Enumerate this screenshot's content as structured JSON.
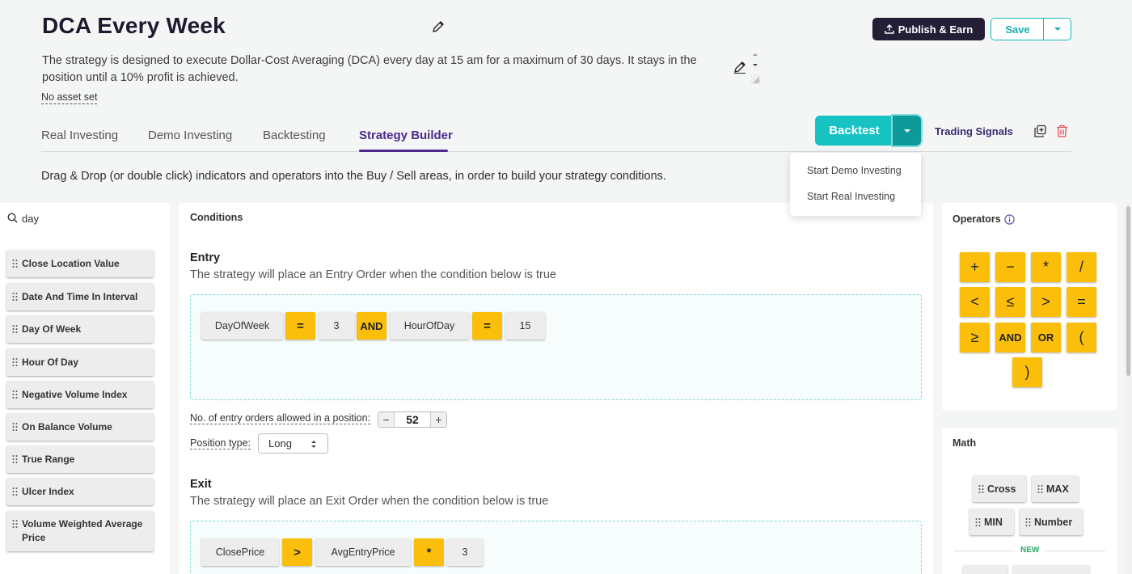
{
  "header": {
    "title": "DCA Every Week",
    "description": "The strategy is designed to execute Dollar-Cost Averaging (DCA) every day at 15 am for a maximum of 30 days. It stays in the position until a 10% profit is achieved.",
    "asset_link": "No asset set",
    "publish_label": "Publish & Earn",
    "save_label": "Save"
  },
  "tabs": [
    {
      "label": "Real Investing"
    },
    {
      "label": "Demo Investing"
    },
    {
      "label": "Backtesting"
    },
    {
      "label": "Strategy Builder",
      "active": true
    }
  ],
  "actions": {
    "backtest_label": "Backtest",
    "trading_signals_label": "Trading Signals",
    "dropdown_items": [
      "Start Demo Investing",
      "Start Real Investing"
    ]
  },
  "hint": "Drag & Drop (or double click) indicators and operators into the Buy / Sell areas, in order to build your strategy conditions.",
  "search": {
    "value": "day"
  },
  "indicators": [
    "Close Location Value",
    "Date And Time In Interval",
    "Day Of Week",
    "Hour Of Day",
    "Negative Volume Index",
    "On Balance Volume",
    "True Range",
    "Ulcer Index",
    "Volume Weighted Average Price"
  ],
  "conditions": {
    "title": "Conditions",
    "entry": {
      "title": "Entry",
      "description": "The strategy will place an Entry Order when the condition below is true",
      "tokens": [
        "DayOfWeek",
        "=",
        "3",
        "AND",
        "HourOfDay",
        "=",
        "15"
      ]
    },
    "entry_orders_label": "No. of entry orders allowed in a position:",
    "entry_orders_value": "52",
    "position_type_label": "Position type:",
    "position_type_value": "Long",
    "exit": {
      "title": "Exit",
      "description": "The strategy will place an Exit Order when the condition below is true",
      "tokens": [
        "ClosePrice",
        ">",
        "AvgEntryPrice",
        "*",
        "3"
      ]
    }
  },
  "operators": {
    "title": "Operators",
    "items": [
      "+",
      "−",
      "*",
      "/",
      "<",
      "≤",
      ">",
      "=",
      "≥",
      "AND",
      "OR",
      "(",
      ")"
    ]
  },
  "math": {
    "title": "Math",
    "items": [
      "Cross",
      "MAX",
      "MIN",
      "Number"
    ],
    "new_label": "NEW"
  },
  "colors": {
    "accent_teal": "#16c2c2",
    "operator_yellow": "#fbbf0b",
    "brand_dark": "#241e37",
    "tab_active": "#4b2a8c"
  },
  "icons": [
    "pencil-icon",
    "upload-icon",
    "copy-icon",
    "trash-icon",
    "search-icon",
    "grip-icon",
    "info-icon"
  ]
}
